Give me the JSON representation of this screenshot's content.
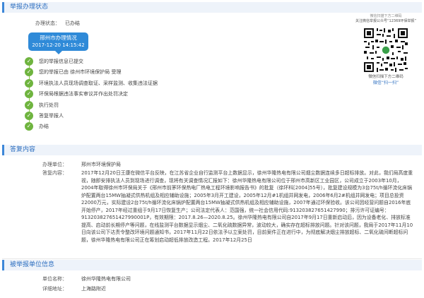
{
  "status_section": {
    "title": "举报办理状态",
    "state_label": "办理状态：",
    "state_value": "已办结",
    "chip_title": "邢州市办理情况",
    "chip_time": "2017-12-20 14:15:42",
    "steps": [
      "您的举报信息已提交",
      "您的举报已由 徐州市环境保护局 受理",
      "环境执法人员现场调查取证、采样监测、收集违法证据",
      "环保局根据违法事实审议并作出处罚决定",
      "执行处罚",
      "答复举报人",
      "办结"
    ],
    "check_color": "#6fb43f"
  },
  "qr": {
    "caption1": "微信扫描下方二维码",
    "caption2": "关注微信举报公众号“12369环保举报”",
    "footer1": "微信扫描下方二维码",
    "footer2": "微信“扫一扫”"
  },
  "content_section": {
    "title": "答复内容",
    "unit_label": "办理单位：",
    "unit_value": "邢州市环境保护局",
    "reply_label": "答复内容：",
    "reply_text": "2017年12月20日王康在微信平台反映，在江苏省企业自行监测平台上数据显示，徐州华隆热电有限公司烟尘数据连续多日超标排放。对此，我们局高度重视，随即安排执法人员到现场进行调查，现将有关调查情况汇报如下：徐州华隆热电有限公司位于邢州市高新区工业园区，公司成立于2003年10月，2004年取得徐州市环保局关于《邢州市前茅环保热电厂热电工程环境影响报告书》的批复（徐环科[2004]55号），批复建设规模为3台75t/h循环流化床锅炉配置两台15MW抽凝式供热机组及相应辅助设施；2005年3月开工建设，2005年12月#1机组并网发电，2006年6月2#机组并网发电；项目总投资22000万元，实际建设2台75t/h循环流化床锅炉配置两台15MW抽凝式供热机组及相应辅助设施，2007年通过环保验收。该公司因经营问题自2016年底开始停产，2017年经过重组于9月17日恢复生产；公司法定代表人：范国强，统一社会信用代码:913203827651427990；排污许可证编号：913203827651427990001P，有效期限：2017.8.26—2020.8.25。徐州华隆热电有限公司自2017年9月17日重新启动后，因为设备老化、排放标准提高、启动前长期停产等问题，在线监测平台数据显示烟尘、二氧化硫数据异常，波动较大，确实存在超标排放问题。针对该问题，我局于2017年11月10日向该公司下达责令整改环境问题通知书，2017年11月22日依法予以立案处罚，目前案件正在进行中，为彻底解决烟尘排放超标、二氧化硫间断超标问题，徐州华隆热电有限公司正在筹划启动超低排放改造工程。2017年12月25日"
  },
  "reported_section": {
    "title": "被举报单位信息",
    "unit_label": "单位名称：",
    "unit_value": "徐州华隆热电有限公司",
    "address_label": "详细地址：",
    "address_value": "上海路附近"
  },
  "colors": {
    "accent": "#2f8ad8",
    "section_bg": "#eef3fa",
    "check": "#6fb43f"
  }
}
